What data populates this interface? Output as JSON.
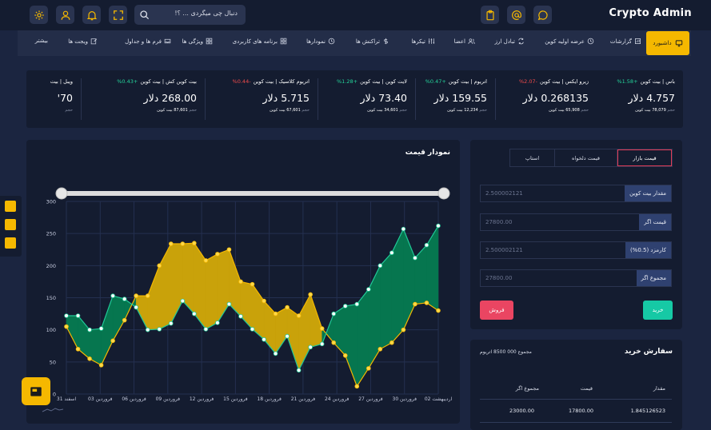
{
  "app": {
    "title": "Crypto Admin"
  },
  "search": {
    "placeholder": "دنبال چی میگردی ... ؟!"
  },
  "header_icons": [
    "gear-icon",
    "user-icon",
    "bell-icon",
    "fullscreen-icon",
    "search-icon",
    "clipboard-icon",
    "at-icon",
    "chat-icon"
  ],
  "nav": {
    "active": "داشبورد",
    "items": [
      {
        "label": "گزارشات",
        "icon": "report-icon"
      },
      {
        "label": "عرضه اولیه کوین",
        "icon": "clock-icon"
      },
      {
        "label": "تبادل ارز",
        "icon": "exchange-icon"
      },
      {
        "label": "اعضا",
        "icon": "users-icon"
      },
      {
        "label": "تیکرها",
        "icon": "sliders-icon"
      },
      {
        "label": "تراکنش ها",
        "icon": "dollar-icon"
      },
      {
        "label": "نمودارها",
        "icon": "chart-icon"
      },
      {
        "label": "برنامه های کاربردی",
        "icon": "apps-icon"
      },
      {
        "label": "ویژگی ها",
        "icon": "grid-icon"
      },
      {
        "label": "فرم ها و جداول",
        "icon": "form-icon"
      },
      {
        "label": "ویجت ها",
        "icon": "edit-icon"
      },
      {
        "label": "بیشتر",
        "icon": ""
      }
    ]
  },
  "ticker": [
    {
      "pair": "باس | بیت کوین",
      "change": "+1.58%",
      "dir": "up",
      "price": "4.757 دلار",
      "volume_label": "حجم",
      "volume": "78,079",
      "unit": "بیت کوین"
    },
    {
      "pair": "زیرو ایکس | بیت کوین",
      "change": "-2.07%",
      "dir": "dn",
      "price": "0.268135 دلار",
      "volume_label": "حجم",
      "volume": "65,908",
      "unit": "بیت کوین"
    },
    {
      "pair": "اتریوم | بیت کوین",
      "change": "+0.47%",
      "dir": "up",
      "price": "159.55 دلار",
      "volume_label": "حجم",
      "volume": "12,234",
      "unit": "بیت کوین"
    },
    {
      "pair": "لایت کوین | بیت کوین",
      "change": "+1.28%",
      "dir": "up",
      "price": "73.40 دلار",
      "volume_label": "حجم",
      "volume": "34,601",
      "unit": "بیت کوین"
    },
    {
      "pair": "اتریوم کلاسیک | بیت کوین",
      "change": "-0.44%",
      "dir": "dn",
      "price": "5.715 دلار",
      "volume_label": "حجم",
      "volume": "67,601",
      "unit": "بیت کوین"
    },
    {
      "pair": "بیت کوین کش | بیت کوین",
      "change": "+0.43%",
      "dir": "up",
      "price": "268.00 دلار",
      "volume_label": "حجم",
      "volume": "87,601",
      "unit": "بیت کوین"
    },
    {
      "pair": "ویبل | بیت",
      "change": "",
      "dir": "up",
      "price": "70'",
      "volume_label": "حجم",
      "volume": "",
      "unit": ""
    }
  ],
  "chart_data": {
    "type": "area",
    "title": "نمودار قیمت",
    "x": [
      "اسفند 31",
      "فروردین 03",
      "فروردین 06",
      "فروردین 09",
      "فروردین 12",
      "فروردین 15",
      "فروردین 18",
      "فروردین 21",
      "فروردین 24",
      "فروردین 27",
      "فروردین 30",
      "اردیبهشت 02"
    ],
    "yticks": [
      0,
      50,
      100,
      150,
      200,
      250,
      300
    ],
    "ylim": [
      0,
      300
    ],
    "series": [
      {
        "color": "#f5b800",
        "values": [
          105,
          70,
          55,
          45,
          83,
          115,
          153,
          153,
          200,
          234,
          234,
          235,
          208,
          218,
          225,
          175,
          171,
          145,
          125,
          135,
          122,
          155,
          102,
          80,
          60,
          12,
          40,
          70,
          80,
          100,
          140,
          142,
          130
        ]
      },
      {
        "color": "#20c997",
        "values": [
          122,
          122,
          100,
          102,
          153,
          148,
          135,
          100,
          101,
          110,
          145,
          125,
          101,
          111,
          140,
          121,
          101,
          85,
          63,
          90,
          37,
          73,
          78,
          125,
          137,
          140,
          163,
          200,
          220,
          257,
          212,
          232,
          262,
          280
        ]
      }
    ],
    "range_slider": [
      0,
      1
    ]
  },
  "order_form": {
    "tabs": [
      "قیمت بازار",
      "قیمت دلخواه",
      "استاپ"
    ],
    "fields": [
      {
        "label": "مقدار بیت کوین",
        "value": "2.500002121"
      },
      {
        "label": "قیمت اگر",
        "value": "27800.00"
      },
      {
        "label": "کارمزد (0.5%)",
        "value": "2.500002121"
      },
      {
        "label": "مجموع اگر",
        "value": "27800.00"
      }
    ],
    "buy": "خرید",
    "sell": "فروش"
  },
  "buy_orders": {
    "title": "سفارش خرید",
    "total": "مجموع 000 8500 اتریوم",
    "columns": [
      "مقدار",
      "قیمت",
      "مجموع اگر"
    ],
    "rows": [
      [
        "1.845126523",
        "17800.00",
        "23000.00"
      ]
    ]
  }
}
